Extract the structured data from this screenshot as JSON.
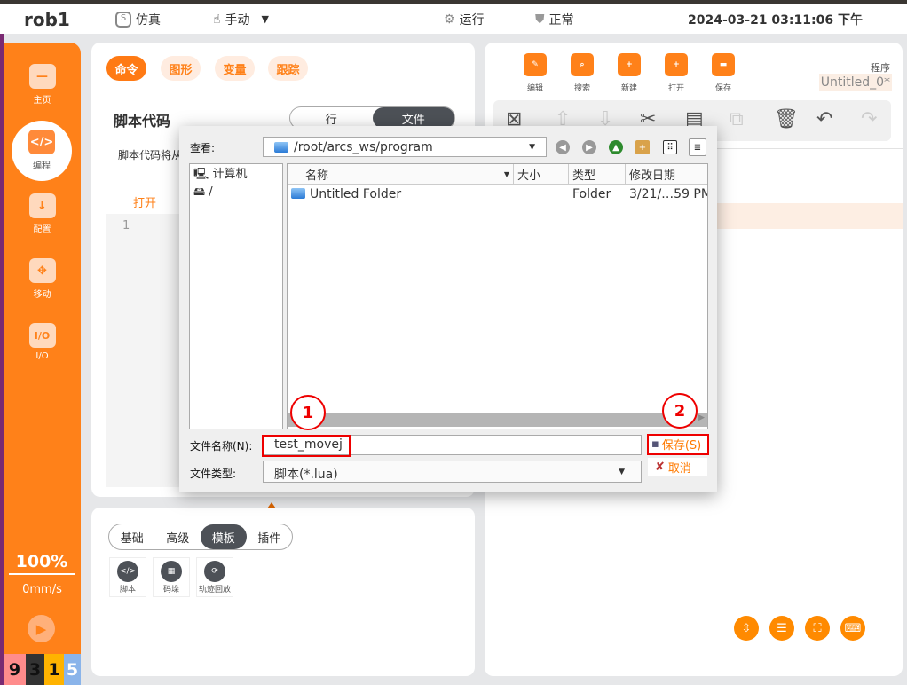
{
  "header": {
    "robot": "rob1",
    "mode": "仿真",
    "control": "手动",
    "state": "运行",
    "safety": "正常",
    "datetime": "2024-03-21 03:11:06 下午"
  },
  "sidebar": {
    "items": [
      {
        "label": "主页",
        "icon": "home-icon"
      },
      {
        "label": "编程",
        "icon": "code-icon"
      },
      {
        "label": "配置",
        "icon": "config-icon"
      },
      {
        "label": "移动",
        "icon": "move-icon"
      },
      {
        "label": "I/O",
        "icon": "io-icon"
      }
    ],
    "speed_percent": "100%",
    "speed": "0mm/s",
    "counters": [
      "9",
      "3",
      "1",
      "5"
    ],
    "counter_colors": [
      "#ff8c8c",
      "#333333",
      "#ffb300",
      "#8ab4ea"
    ]
  },
  "left_panel": {
    "tabs": [
      "命令",
      "图形",
      "变量",
      "跟踪"
    ],
    "title": "脚本代码",
    "segment": [
      "行",
      "文件"
    ],
    "desc": "脚本代码将从",
    "open": "打开",
    "line": "1"
  },
  "bottom_panel": {
    "tabs": [
      "基础",
      "高级",
      "模板",
      "插件"
    ],
    "templates": [
      "脚本",
      "码垛",
      "轨迹回放"
    ]
  },
  "right_panel": {
    "toolbar": [
      "编辑",
      "搜索",
      "新建",
      "打开",
      "保存"
    ],
    "program_label": "程序",
    "program_name": "Untitled_0*"
  },
  "dialog": {
    "look_in_label": "查看:",
    "path": "/root/arcs_ws/program",
    "places": [
      "计算机",
      "/"
    ],
    "columns": [
      "名称",
      "大小",
      "类型",
      "修改日期"
    ],
    "files": [
      {
        "name": "Untitled Folder",
        "size": "",
        "type": "Folder",
        "date": "3/21/…59 PM"
      }
    ],
    "filename_label": "文件名称(N):",
    "filename": "test_movej",
    "filetype_label": "文件类型:",
    "filetype": "脚本(*.lua)",
    "save": "保存(S)",
    "cancel": "取消"
  },
  "annotations": [
    "1",
    "2"
  ],
  "colors": {
    "accent": "#ff8119",
    "annotation": "#e00000"
  }
}
